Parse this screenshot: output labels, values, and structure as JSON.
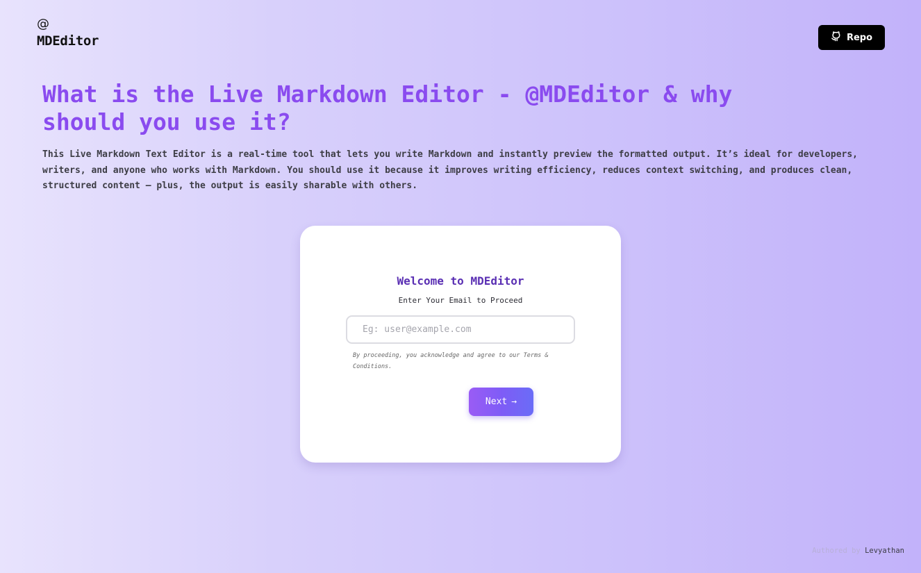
{
  "logo": {
    "symbol": "@",
    "text": "MDEditor"
  },
  "header": {
    "repo_label": "Repo",
    "repo_icon": "github-icon"
  },
  "hero": {
    "title": "What is the Live Markdown Editor - @MDEditor & why should you use it?",
    "description": "This Live Markdown Text Editor is a real-time tool that lets you write Markdown and instantly preview the formatted output. It’s ideal for developers, writers, and anyone who works with Markdown. You should use it because it improves writing efficiency, reduces context switching, and produces clean, structured content — plus, the output is easily sharable with others."
  },
  "card": {
    "title": "Welcome to MDEditor",
    "subtitle": "Enter Your Email to Proceed",
    "email_placeholder": "Eg: user@example.com",
    "email_value": "",
    "terms": "By proceeding, you acknowledge and agree to our Terms & Conditions.",
    "next_label": "Next",
    "next_arrow": "→"
  },
  "footer": {
    "prefix": "Authored by",
    "author": "Levyathan"
  },
  "colors": {
    "accent": "#8a4bef",
    "card_title": "#5a2fb3",
    "repo_bg": "#000000"
  }
}
